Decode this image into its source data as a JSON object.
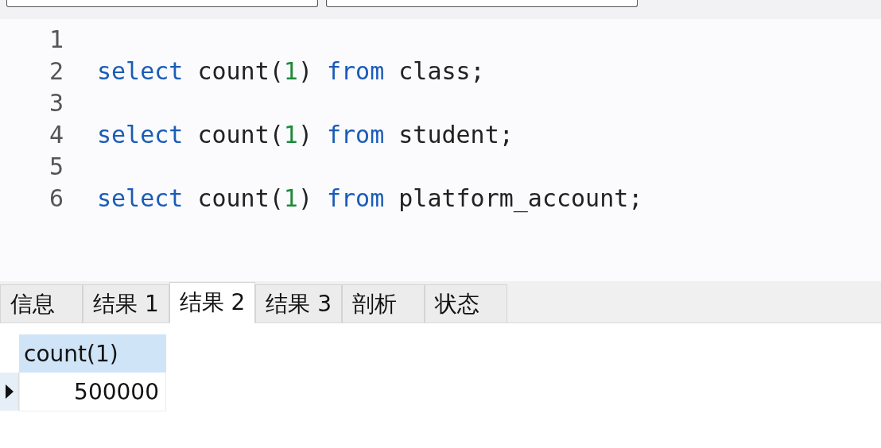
{
  "editor": {
    "lines": [
      {
        "number": "1"
      },
      {
        "number": "2",
        "tokens": [
          {
            "kind": "keyword",
            "text": "select"
          },
          {
            "kind": "plain",
            "text": " count("
          },
          {
            "kind": "number",
            "text": "1"
          },
          {
            "kind": "plain",
            "text": ") "
          },
          {
            "kind": "keyword",
            "text": "from"
          },
          {
            "kind": "plain",
            "text": " class;"
          }
        ]
      },
      {
        "number": "3"
      },
      {
        "number": "4",
        "tokens": [
          {
            "kind": "keyword",
            "text": "select"
          },
          {
            "kind": "plain",
            "text": " count("
          },
          {
            "kind": "number",
            "text": "1"
          },
          {
            "kind": "plain",
            "text": ") "
          },
          {
            "kind": "keyword",
            "text": "from"
          },
          {
            "kind": "plain",
            "text": " student;"
          }
        ]
      },
      {
        "number": "5"
      },
      {
        "number": "6",
        "tokens": [
          {
            "kind": "keyword",
            "text": "select"
          },
          {
            "kind": "plain",
            "text": " count("
          },
          {
            "kind": "number",
            "text": "1"
          },
          {
            "kind": "plain",
            "text": ") "
          },
          {
            "kind": "keyword",
            "text": "from"
          },
          {
            "kind": "plain",
            "text": " platform_account;"
          }
        ]
      }
    ]
  },
  "tabs": [
    {
      "label": "信息",
      "selected": false
    },
    {
      "label": "结果 1",
      "selected": false
    },
    {
      "label": "结果 2",
      "selected": true
    },
    {
      "label": "结果 3",
      "selected": false
    },
    {
      "label": "剖析",
      "selected": false
    },
    {
      "label": "状态",
      "selected": false
    }
  ],
  "result_grid": {
    "columns": [
      "count(1)"
    ],
    "rows": [
      {
        "current": true,
        "cells": [
          "500000"
        ]
      }
    ]
  }
}
